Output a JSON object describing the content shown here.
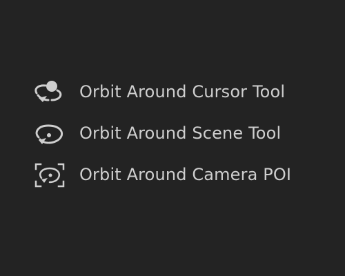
{
  "tools": [
    {
      "label": "Orbit Around Cursor Tool",
      "icon": "orbit-around-cursor-icon"
    },
    {
      "label": "Orbit Around Scene Tool",
      "icon": "orbit-around-scene-icon"
    },
    {
      "label": "Orbit Around Camera POI",
      "icon": "orbit-around-camera-poi-icon"
    }
  ],
  "colors": {
    "background": "#232323",
    "text": "#cfcfcf",
    "icon": "#cfcfcf"
  }
}
